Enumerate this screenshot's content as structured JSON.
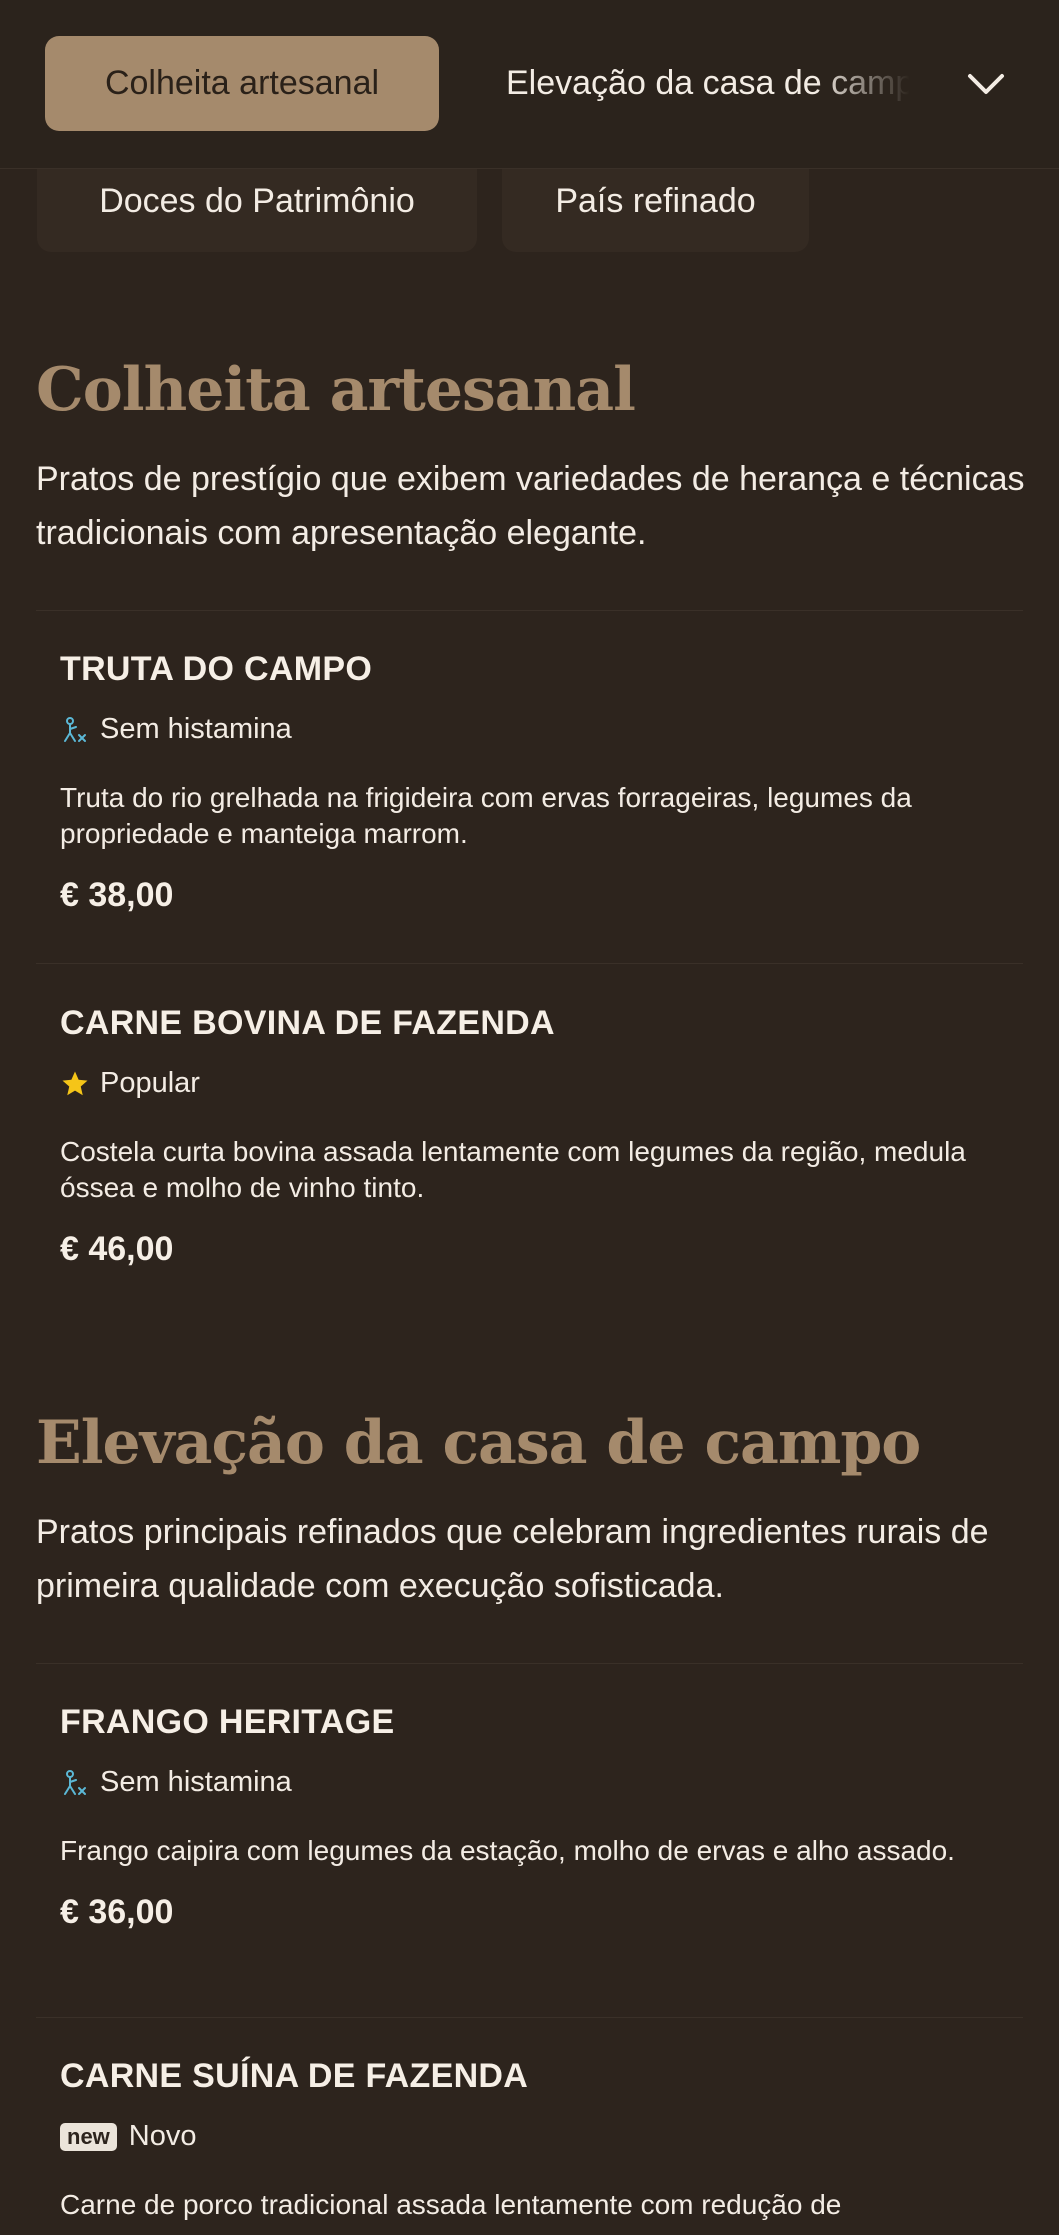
{
  "nav": {
    "active_tab": "Colheita artesanal",
    "next_tab": "Elevação da casa de campo",
    "chevron_icon": "chevron-down-icon",
    "chips": [
      "Doces do Patrimônio",
      "País refinado"
    ]
  },
  "sections": [
    {
      "title": "Colheita artesanal",
      "description": "Pratos de prestígio que exibem variedades de herança e técnicas tradicionais com apresentação elegante.",
      "items": [
        {
          "name": "TRUTA DO CAMPO",
          "tag_icon": "histamine-free-icon",
          "tag": "Sem histamina",
          "description": "Truta do rio grelhada na frigideira com ervas forrageiras, legumes da propriedade e manteiga marrom.",
          "price": "€ 38,00"
        },
        {
          "name": "CARNE BOVINA DE FAZENDA",
          "tag_icon": "star-icon",
          "tag": "Popular",
          "description": "Costela curta bovina assada lentamente com legumes da região, medula óssea e molho de vinho tinto.",
          "price": "€ 46,00"
        }
      ]
    },
    {
      "title": "Elevação da casa de campo",
      "description": "Pratos principais refinados que celebram ingredientes rurais de primeira qualidade com execução sofisticada.",
      "items": [
        {
          "name": "FRANGO HERITAGE",
          "tag_icon": "histamine-free-icon",
          "tag": "Sem histamina",
          "description": "Frango caipira com legumes da estação, molho de ervas e alho assado.",
          "price": "€ 36,00"
        },
        {
          "name": "CARNE SUÍNA DE FAZENDA",
          "tag_icon": "new-badge",
          "badge": "new",
          "tag": "Novo",
          "description": "Carne de porco tradicional assada lentamente com redução de"
        }
      ]
    }
  ],
  "colors": {
    "background": "#2d241d",
    "accent": "#a58a6c",
    "text": "#f3ece4",
    "histamine_icon": "#5bb8d6",
    "star": "#f5c518"
  }
}
